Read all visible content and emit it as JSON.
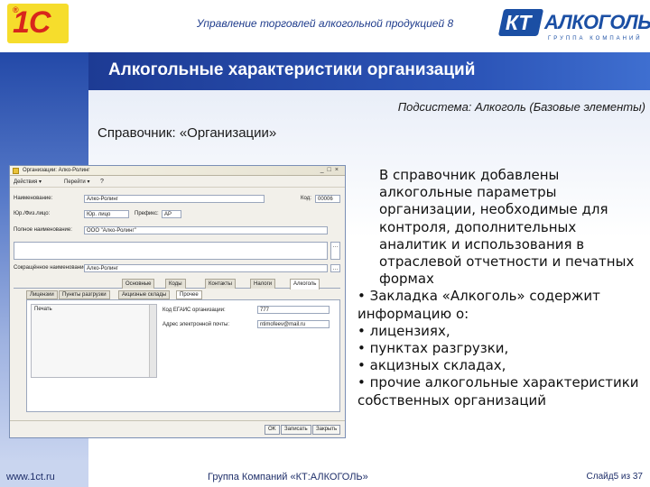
{
  "header": {
    "logo_1c": "1С",
    "title": "Управление торговлей алкогольной продукцией 8",
    "kt_logo_box": "КТ",
    "kt_logo_name": "АЛКОГОЛЬ",
    "kt_logo_sub": "ГРУППА КОМПАНИЙ"
  },
  "slide": {
    "title": "Алкогольные характеристики организаций",
    "subsystem": "Подсистема: Алкоголь (Базовые элементы)",
    "directory": "Справочник: «Организации»"
  },
  "screenshot": {
    "window_title": "Организации: Алко-Ролинг",
    "toolbar": [
      "Действия ▾",
      "Перейти ▾"
    ],
    "fields": {
      "name_label": "Наименование:",
      "name_value": "Алко-Ролинг",
      "code_label": "Код:",
      "code_value": "00006",
      "prefix_label": "Юр./Физ.лицо:",
      "prefix_value": "Юр. лицо",
      "prefix2_label": "Префикс:",
      "prefix2_value": "АР",
      "fullname_label": "Полное наименование:",
      "fullname_value": "ООО \"Алко-Ролинг\"",
      "short_label": "Сокращённое наименование:",
      "short_value": "Алко-Ролинг"
    },
    "tabs": [
      "Основные",
      "Коды",
      "Контакты",
      "Налоги",
      "Алкоголь"
    ],
    "subtabs": [
      "Лицензии",
      "Пункты разгрузки",
      "Акцизные склады",
      "Прочее"
    ],
    "list_header": "Печать",
    "right_rows": [
      {
        "label": "Код ЕГАИС организации:",
        "value": "777"
      },
      {
        "label": "Адрес электронной почты:",
        "value": "ntimofeev@mail.ru"
      }
    ],
    "footer_buttons": [
      "OK",
      "Записать",
      "Закрыть"
    ]
  },
  "description": {
    "intro": "В справочник добавлены алкогольные параметры организации, необходимые для контроля, дополнительных аналитик и использования в отраслевой отчетности и печатных формах",
    "bullet1": "Закладка «Алкоголь» содержит информацию о:",
    "items": [
      "лицензиях,",
      "пунктах разгрузки,",
      "акцизных складах,",
      "прочие алкогольные характеристики собственных организаций"
    ]
  },
  "footer": {
    "website": "www.1ct.ru",
    "company": "Группа Компаний «КТ:АЛКОГОЛЬ»",
    "slide_num": "Слайд5 из 37"
  }
}
